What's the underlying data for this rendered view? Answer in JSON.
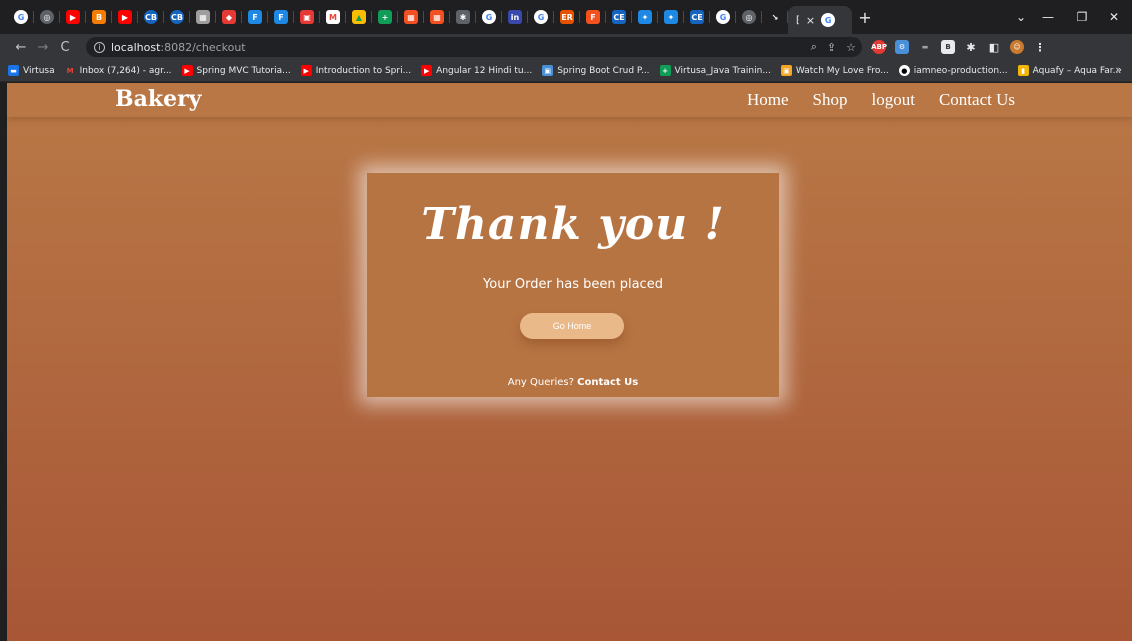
{
  "browser": {
    "active_tab_close": "×",
    "new_tab": "+",
    "window_controls": {
      "minimize": "—",
      "restore": "❐",
      "close": "✕",
      "tab_search": "⌄"
    },
    "url_host": "localhost",
    "url_rest": ":8082/checkout",
    "bookmarks": [
      {
        "label": "Virtusa",
        "color": "#1a73e8"
      },
      {
        "label": "Inbox (7,264) - agr...",
        "color": "#ea4335",
        "glyph": "M"
      },
      {
        "label": "Spring MVC Tutoria...",
        "color": "#ff0000",
        "glyph": "▶"
      },
      {
        "label": "Introduction to Spri...",
        "color": "#ff0000",
        "glyph": "▶"
      },
      {
        "label": "Angular 12 Hindi tu...",
        "color": "#ff0000",
        "glyph": "▶"
      },
      {
        "label": "Spring Boot Crud P...",
        "color": "#4a90d9",
        "glyph": "▣"
      },
      {
        "label": "Virtusa_Java Trainin...",
        "color": "#0f9d58",
        "glyph": "+"
      },
      {
        "label": "Watch My Love Fro...",
        "color": "#f5a623",
        "glyph": "▣"
      },
      {
        "label": "iamneo-production...",
        "color": "#ffffff",
        "glyph": "●"
      },
      {
        "label": "Aquafy – Aqua Far...",
        "color": "#f2b705",
        "glyph": "▮"
      }
    ],
    "bookmarks_more": "»"
  },
  "site": {
    "brand": "Bakery",
    "nav": [
      "Home",
      "Shop",
      "logout",
      "Contact Us"
    ]
  },
  "card": {
    "heading": "Thank you !",
    "message": "Your Order has been placed",
    "button": "Go Home",
    "queries_prefix": "Any Queries?",
    "queries_link": "Contact Us"
  }
}
